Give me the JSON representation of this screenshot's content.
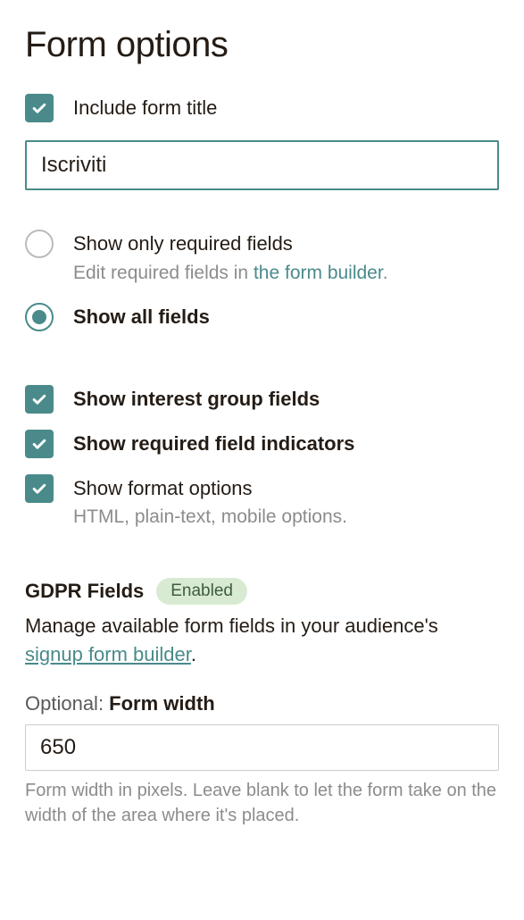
{
  "title": "Form options",
  "includeFormTitle": {
    "label": "Include form title",
    "value": "Iscriviti"
  },
  "fieldsVisibility": {
    "onlyRequired": {
      "label": "Show only required fields",
      "hint_prefix": "Edit required fields in ",
      "hint_link": "the form builder",
      "hint_suffix": "."
    },
    "allFields": {
      "label": "Show all fields"
    }
  },
  "checkboxes": {
    "interestGroups": "Show interest group fields",
    "requiredIndicators": "Show required field indicators",
    "formatOptions": {
      "label": "Show format options",
      "hint": "HTML, plain-text, mobile options."
    }
  },
  "gdpr": {
    "title": "GDPR Fields",
    "badge": "Enabled",
    "desc_prefix": "Manage available form fields in your audience's ",
    "desc_link": "signup form builder",
    "desc_suffix": "."
  },
  "formWidth": {
    "prefix": "Optional: ",
    "label": "Form width",
    "value": "650",
    "help": "Form width in pixels. Leave blank to let the form take on the width of the area where it's placed."
  }
}
